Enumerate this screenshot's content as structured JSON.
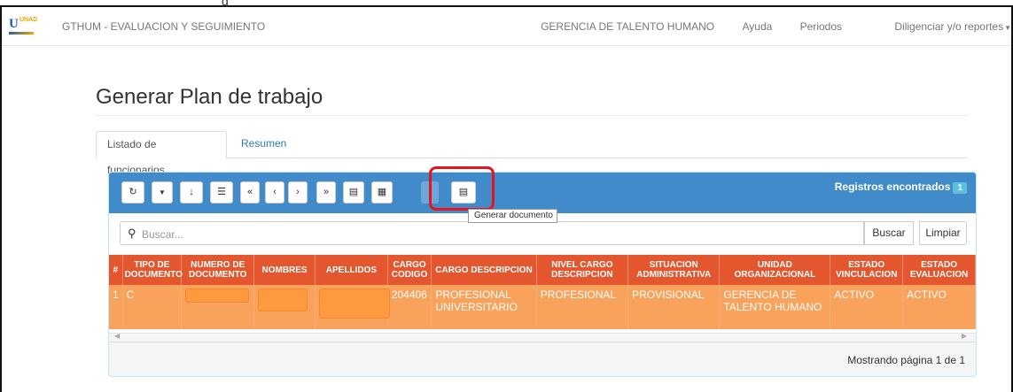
{
  "navbar": {
    "logo_text": "UNAD",
    "title": "GTHUM - EVALUACION Y SEGUIMIENTO",
    "links": [
      {
        "label": "GERENCIA DE TALENTO HUMANO"
      },
      {
        "label": "Ayuda"
      },
      {
        "label": "Periodos"
      },
      {
        "label": "Diligenciar y/o reportes"
      }
    ]
  },
  "page": {
    "title": "Generar Plan de trabajo",
    "tabs": [
      {
        "label": "Listado de funcionarios",
        "active": true
      },
      {
        "label": "Resumen",
        "active": false
      }
    ]
  },
  "toolbar": {
    "buttons": [
      {
        "icon": "refresh-icon",
        "glyph": "↻"
      },
      {
        "icon": "filter-icon",
        "glyph": "▼"
      },
      {
        "icon": "sort-icon",
        "glyph": "↓"
      },
      {
        "icon": "list-icon",
        "glyph": "☰"
      },
      {
        "icon": "first-page-icon",
        "glyph": "«"
      },
      {
        "icon": "prev-page-icon",
        "glyph": "‹"
      },
      {
        "icon": "next-page-icon",
        "glyph": "›"
      },
      {
        "icon": "last-page-icon",
        "glyph": "»"
      },
      {
        "icon": "pdf-export-icon",
        "glyph": "▤"
      },
      {
        "icon": "excel-export-icon",
        "glyph": "▦"
      },
      {
        "icon": "disabled-icon",
        "glyph": "▤"
      },
      {
        "icon": "generate-document-icon",
        "glyph": "▤"
      }
    ],
    "registros_label": "Registros encontrados",
    "registros_count": "1",
    "tooltip": "Generar documento"
  },
  "search": {
    "placeholder": "Buscar...",
    "buscar_label": "Buscar",
    "limpiar_label": "Limpiar"
  },
  "table": {
    "headers": [
      "#",
      "TIPO DE DOCUMENTO",
      "NUMERO DE DOCUMENTO",
      "NOMBRES",
      "APELLIDOS",
      "CARGO CODIGO",
      "CARGO DESCRIPCION",
      "NIVEL CARGO DESCRIPCION",
      "SITUACION ADMINISTRATIVA",
      "UNIDAD ORGANIZACIONAL",
      "ESTADO VINCULACION",
      "ESTADO EVALUACION"
    ],
    "rows": [
      {
        "num": "1",
        "tipo": "C",
        "numero": "",
        "nombres": "",
        "apellidos": "",
        "cargo_codigo": "204406",
        "cargo_descripcion": "PROFESIONAL UNIVERSITARIO",
        "nivel": "PROFESIONAL",
        "situacion": "PROVISIONAL",
        "unidad": "GERENCIA DE TALENTO HUMANO",
        "vinculacion": "ACTIVO",
        "evaluacion": "ACTIVO"
      }
    ]
  },
  "footer": {
    "pager": "Mostrando página 1 de 1"
  },
  "colors": {
    "panel_heading": "#428bca",
    "table_header": "#e4572e",
    "table_row": "#f9a25c",
    "highlight": "#e8141c"
  }
}
